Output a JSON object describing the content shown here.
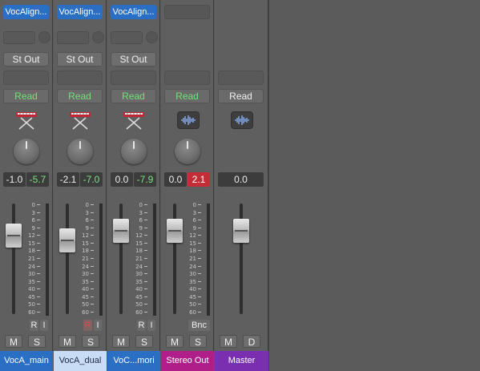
{
  "strips": [
    {
      "plugin": "VocAlign...",
      "output": "St Out",
      "automation": "Read",
      "automation_color": "green",
      "icon": "keyboard-instrument-icon",
      "volume": "-1.0",
      "peak": "-5.7",
      "fader_level_db": "-10",
      "ri_r": "R",
      "ri_i": "I",
      "mute": "M",
      "solo": "S",
      "name": "VocA_main",
      "name_color": "#2a6fc3"
    },
    {
      "plugin": "VocAlign...",
      "output": "St Out",
      "automation": "Read",
      "automation_color": "green",
      "icon": "keyboard-instrument-icon",
      "volume": "-2.1",
      "peak": "-7.0",
      "fader_level_db": "-12",
      "ri_r": "R",
      "ri_i": "I",
      "mute": "M",
      "solo": "S",
      "name": "VocA_dual",
      "name_color": "#c9dcf5"
    },
    {
      "plugin": "VocAlign...",
      "output": "St Out",
      "automation": "Read",
      "automation_color": "green",
      "icon": "keyboard-instrument-icon",
      "volume": "0.0",
      "peak": "-7.9",
      "fader_level_db": "-8",
      "ri_r": "R",
      "ri_i": "I",
      "mute": "M",
      "solo": "S",
      "name": "VoC...mori",
      "name_color": "#2a6fc3"
    },
    {
      "plugin": "",
      "output": "",
      "automation": "Read",
      "automation_color": "green",
      "icon": "audio-waveform-icon",
      "volume": "0.0",
      "peak": "2.1",
      "fader_level_db": "-8",
      "bnc": "Bnc",
      "mute": "M",
      "solo": "S",
      "name": "Stereo Out",
      "name_color": "#b01e8a"
    },
    {
      "plugin": "",
      "output": "",
      "automation": "Read",
      "automation_color": "white",
      "icon": "audio-waveform-icon",
      "volume": "0.0",
      "fader_level_db": "-8",
      "mute": "M",
      "solo": "D",
      "name": "Master",
      "name_color": "#7a2fb0"
    }
  ],
  "fader_scale": [
    "0",
    "3",
    "6",
    "9",
    "12",
    "15",
    "18",
    "21",
    "24",
    "30",
    "35",
    "40",
    "45",
    "50",
    "60"
  ]
}
